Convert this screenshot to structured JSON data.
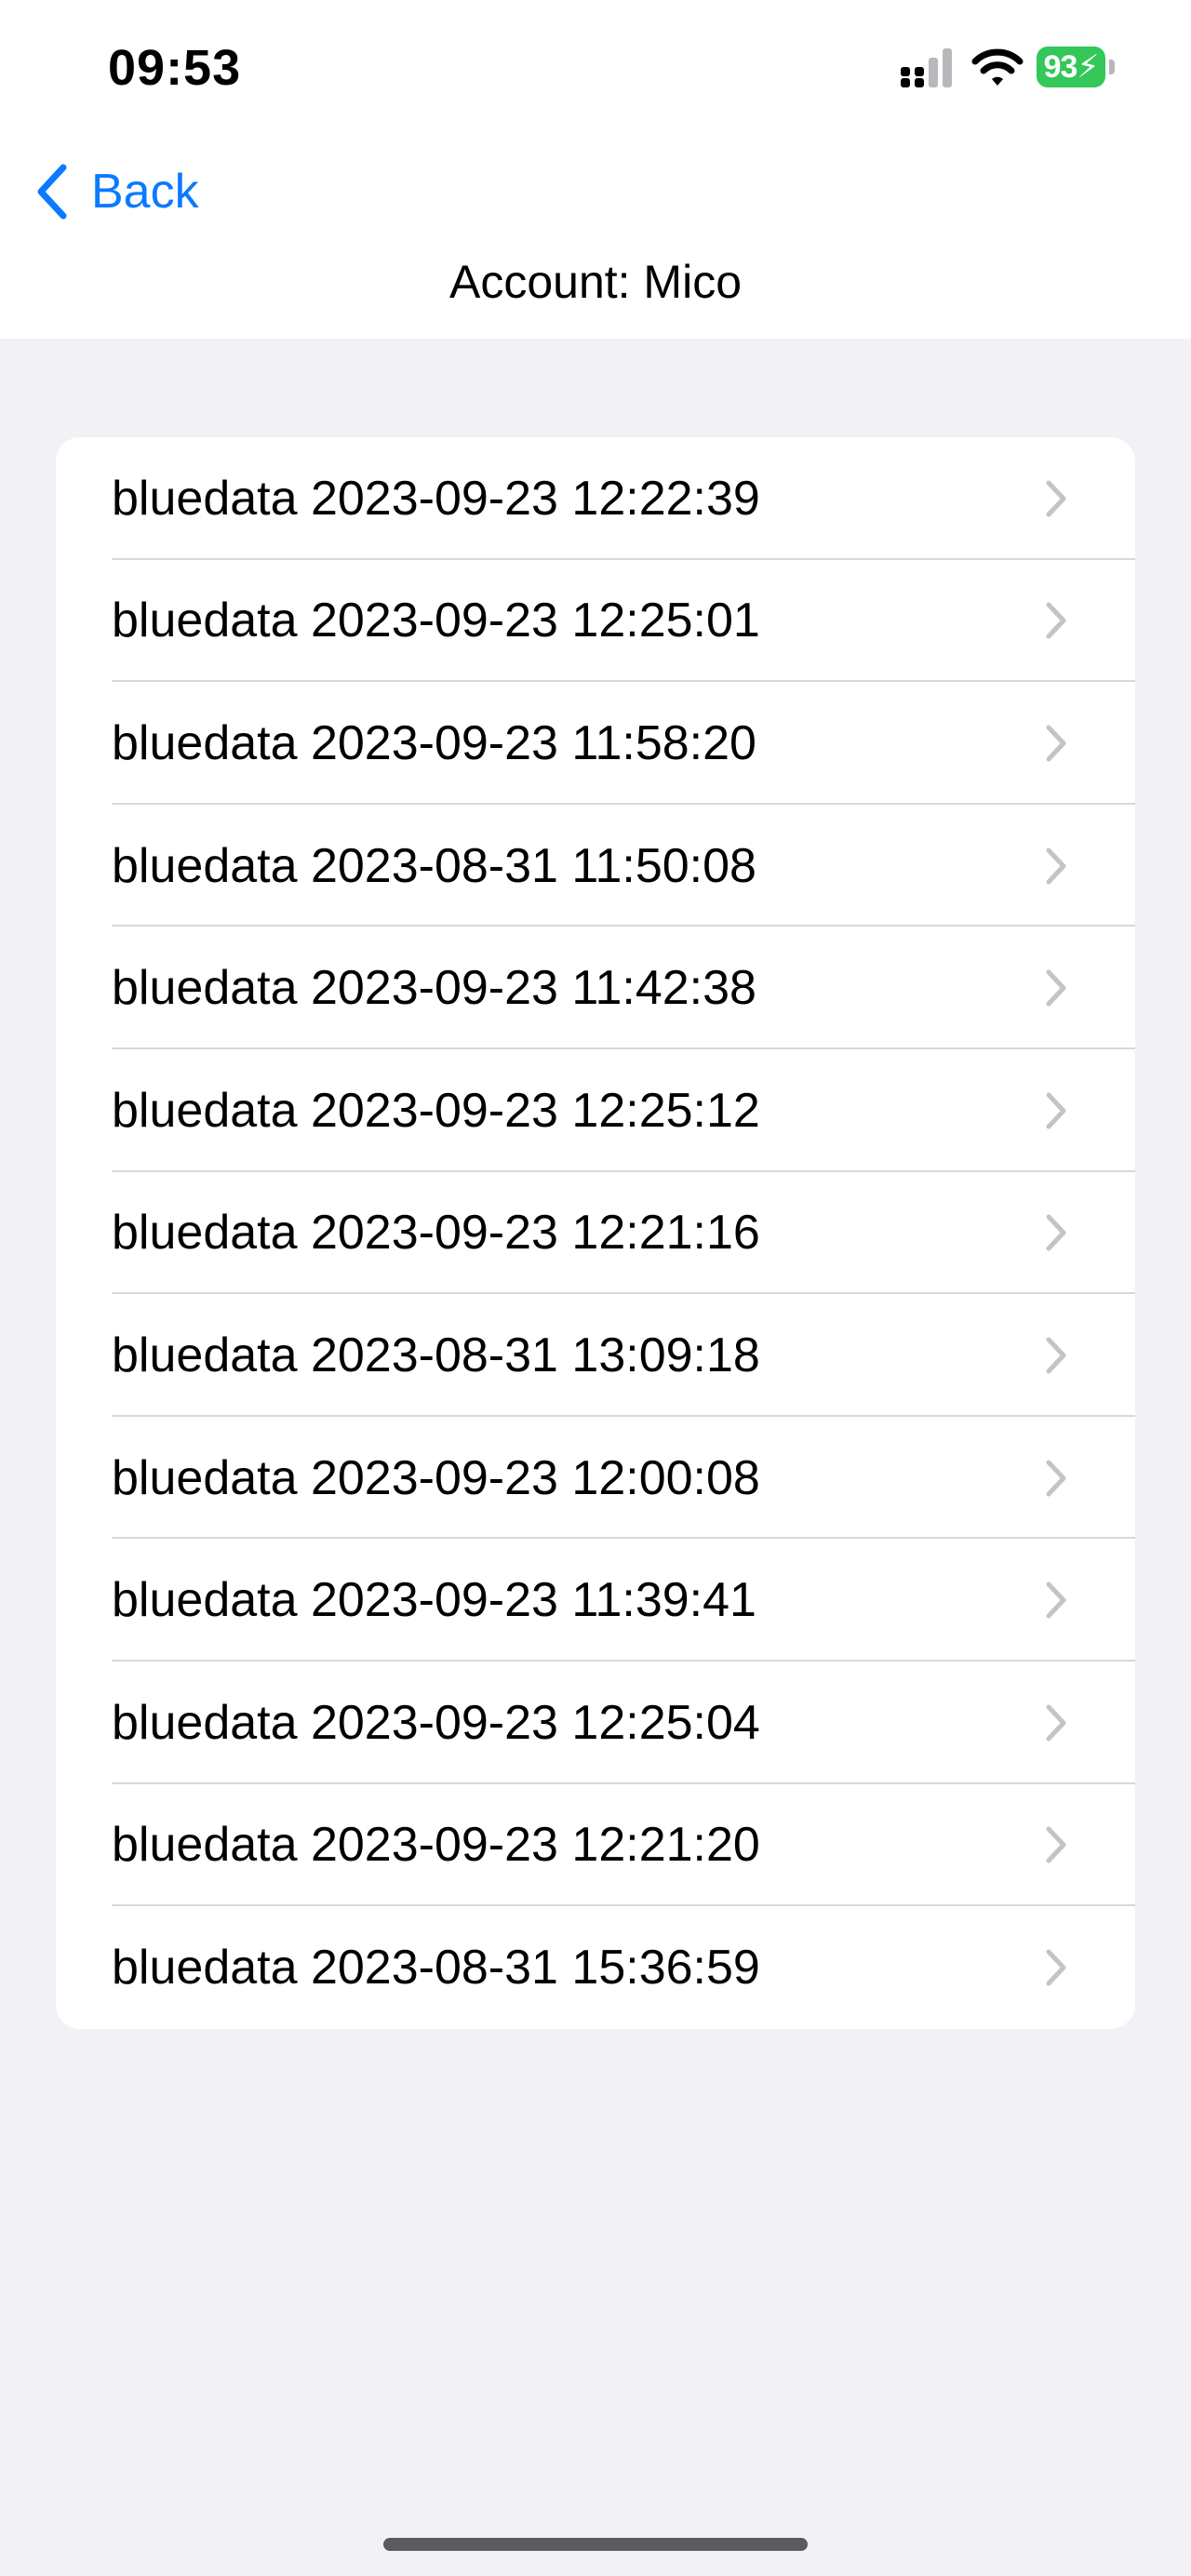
{
  "status_bar": {
    "time": "09:53",
    "battery_level": "93",
    "icons": [
      "signal-icon",
      "wifi-icon",
      "battery-charging-icon"
    ],
    "battery_color": "#34c759"
  },
  "nav": {
    "back_label": "Back",
    "title": "Account: Mico",
    "accent_color": "#0a7aff"
  },
  "list": {
    "items": [
      {
        "label": "bluedata 2023-09-23 12:22:39"
      },
      {
        "label": "bluedata 2023-09-23 12:25:01"
      },
      {
        "label": "bluedata 2023-09-23 11:58:20"
      },
      {
        "label": "bluedata 2023-08-31 11:50:08"
      },
      {
        "label": "bluedata 2023-09-23 11:42:38"
      },
      {
        "label": "bluedata 2023-09-23 12:25:12"
      },
      {
        "label": "bluedata 2023-09-23 12:21:16"
      },
      {
        "label": "bluedata 2023-08-31 13:09:18"
      },
      {
        "label": "bluedata 2023-09-23 12:00:08"
      },
      {
        "label": "bluedata 2023-09-23 11:39:41"
      },
      {
        "label": "bluedata 2023-09-23 12:25:04"
      },
      {
        "label": "bluedata 2023-09-23 12:21:20"
      },
      {
        "label": "bluedata 2023-08-31 15:36:59"
      }
    ]
  }
}
